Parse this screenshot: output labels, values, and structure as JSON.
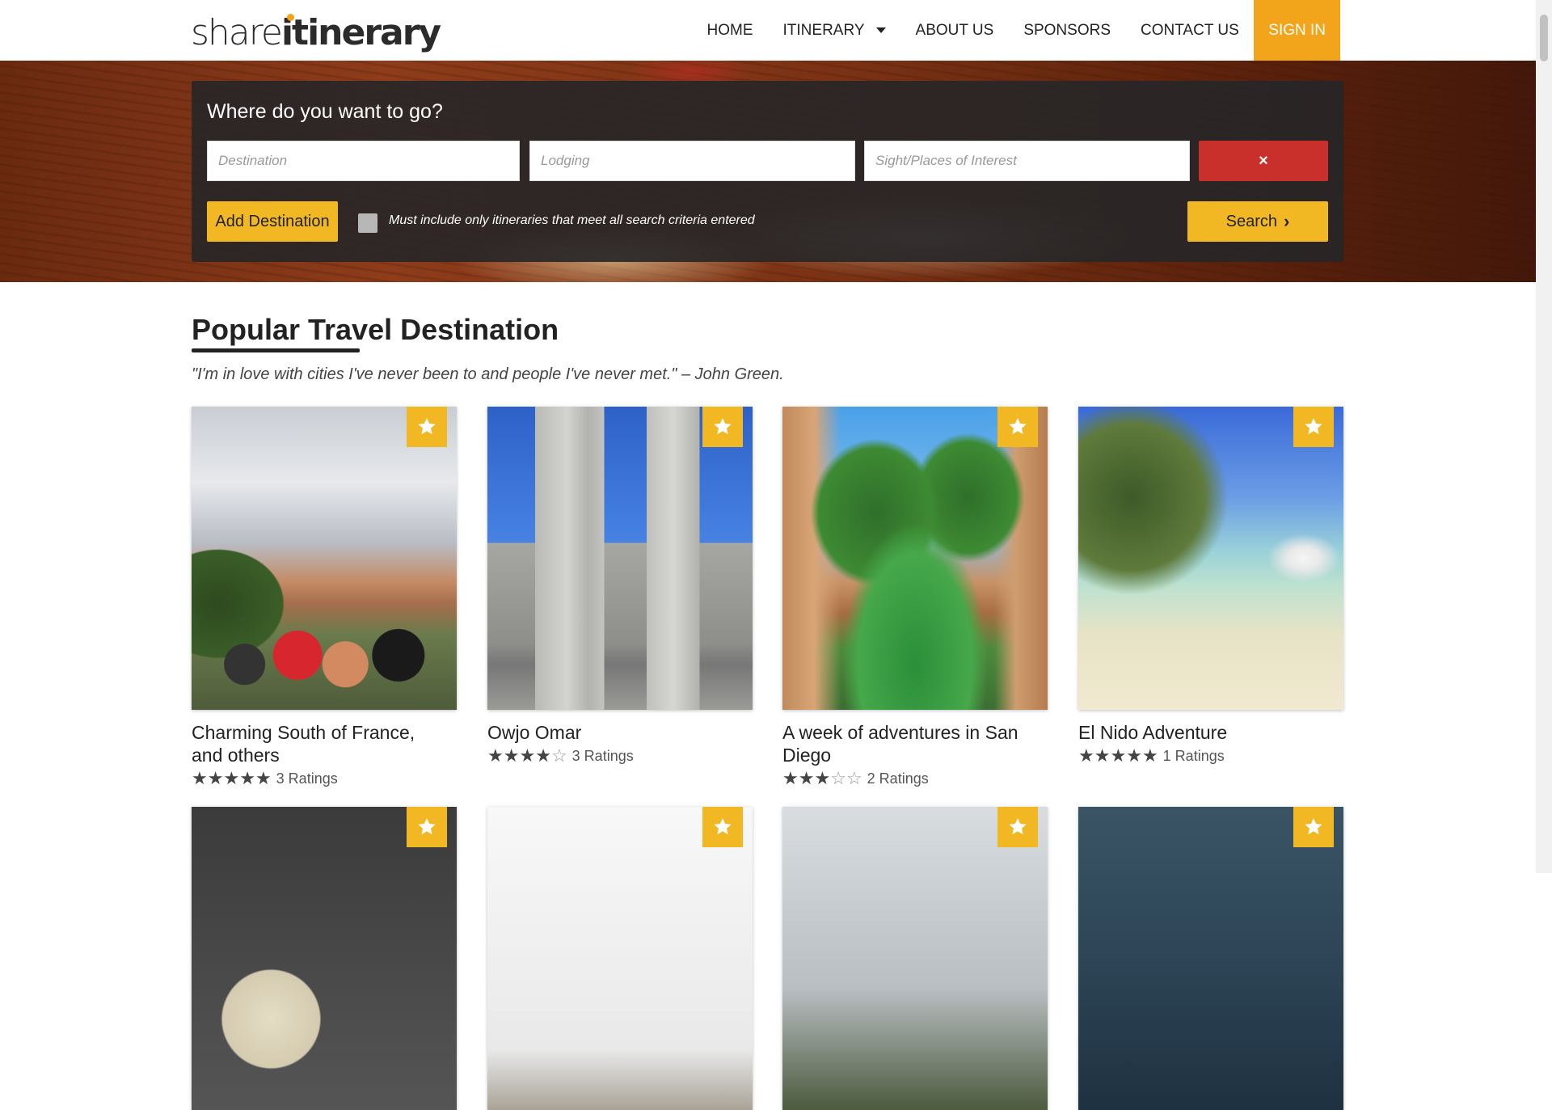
{
  "nav": {
    "logo_light": "share",
    "logo_bold": "itinerary",
    "items": [
      {
        "label": "HOME"
      },
      {
        "label": "ITINERARY"
      },
      {
        "label": "ABOUT US"
      },
      {
        "label": "SPONSORS"
      },
      {
        "label": "CONTACT US"
      },
      {
        "label": "SIGN IN"
      }
    ],
    "accent_color": "#f2a51a"
  },
  "search": {
    "title": "Where do you want to go?",
    "destination_placeholder": "Destination",
    "lodging_placeholder": "Lodging",
    "sights_placeholder": "Sight/Places of Interest",
    "clear_icon": "×",
    "add_label": "Add Destination",
    "checkbox_label": "Must include only itineraries that meet all search criteria entered",
    "checkbox_checked": false,
    "search_label": "Search",
    "search_icon": "chevron-right-icon"
  },
  "section": {
    "title": "Popular Travel Destination",
    "quote": "\"I'm in love with cities I've never been to and people I've never met.\" – John Green."
  },
  "cards": [
    {
      "title": "Charming South of France, and others",
      "rating": 5,
      "ratings_text": "3 Ratings"
    },
    {
      "title": "Owjo Omar",
      "rating": 4,
      "ratings_text": "3 Ratings"
    },
    {
      "title": "A week of adventures in San Diego",
      "rating": 3,
      "ratings_text": "2 Ratings"
    },
    {
      "title": "El Nido Adventure",
      "rating": 5,
      "ratings_text": "1 Ratings"
    },
    {
      "title": ""
    },
    {
      "title": ""
    },
    {
      "title": ""
    },
    {
      "title": ""
    }
  ]
}
